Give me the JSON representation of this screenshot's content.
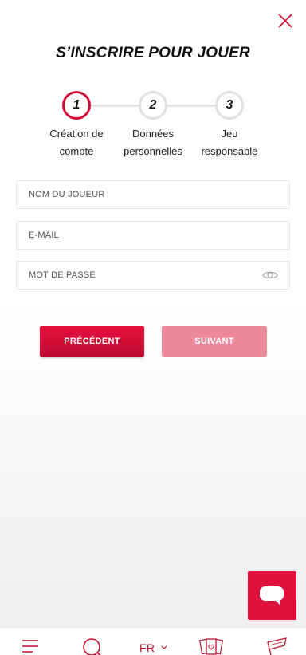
{
  "header": {
    "title": "S’INSCRIRE POUR JOUER",
    "close_icon": "close-icon"
  },
  "stepper": {
    "steps": [
      {
        "number": "1",
        "label": "Création de compte",
        "active": true
      },
      {
        "number": "2",
        "label": "Données personnelles",
        "active": false
      },
      {
        "number": "3",
        "label": "Jeu responsable",
        "active": false
      }
    ]
  },
  "form": {
    "username": {
      "placeholder": "NOM DU JOUEUR",
      "value": ""
    },
    "email": {
      "placeholder": "E-MAIL",
      "value": ""
    },
    "password": {
      "placeholder": "MOT DE PASSE",
      "value": "",
      "toggle_icon": "eye-icon"
    }
  },
  "buttons": {
    "previous": "PRÉCÉDENT",
    "next": "SUIVANT"
  },
  "chat": {
    "icon": "chat-bubble-icon"
  },
  "bottom_nav": {
    "menu_icon": "menu-icon",
    "search_icon": "search-icon",
    "language": "FR",
    "cards_icon": "cards-icon",
    "start_icon": "start-flag-icon"
  },
  "colors": {
    "accent": "#d0103a",
    "button_primary": "#e0103c",
    "button_disabled": "#ec8a9c",
    "step_inactive": "#e2e2e2"
  }
}
